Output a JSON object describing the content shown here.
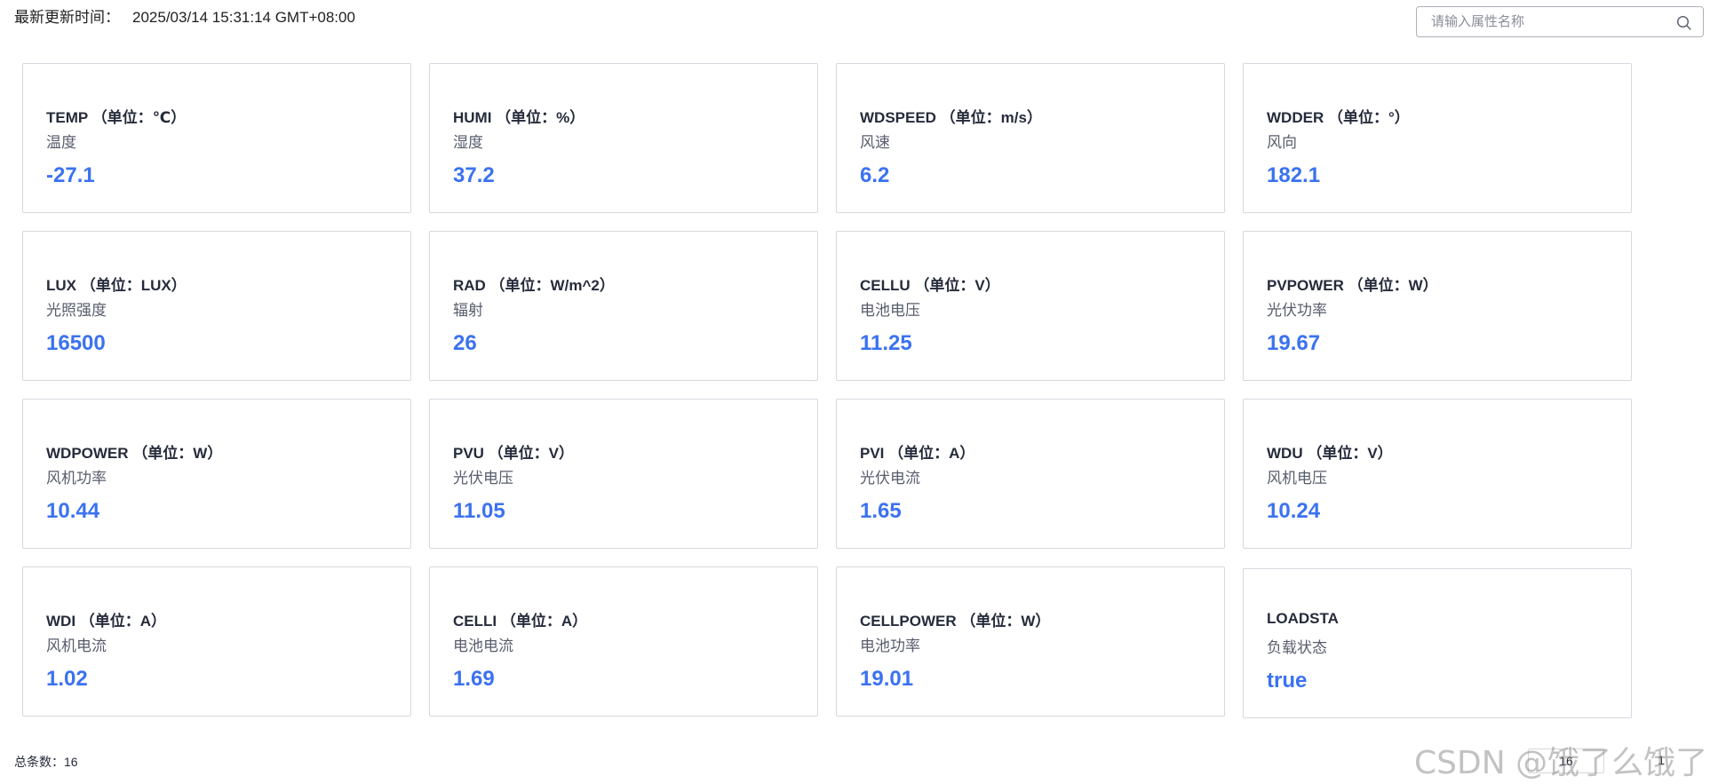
{
  "header": {
    "update_label": "最新更新时间：",
    "update_time": "2025/03/14 15:31:14 GMT+08:00"
  },
  "search": {
    "placeholder": "请输入属性名称",
    "value": ""
  },
  "cards": [
    {
      "title": "TEMP （单位：℃）",
      "desc": "温度",
      "value": "-27.1"
    },
    {
      "title": "HUMI （单位：%）",
      "desc": "湿度",
      "value": "37.2"
    },
    {
      "title": "WDSPEED （单位：m/s）",
      "desc": "风速",
      "value": "6.2"
    },
    {
      "title": "WDDER （单位：°）",
      "desc": "风向",
      "value": "182.1"
    },
    {
      "title": "LUX （单位：LUX）",
      "desc": "光照强度",
      "value": "16500"
    },
    {
      "title": "RAD （单位：W/m^2）",
      "desc": "辐射",
      "value": "26"
    },
    {
      "title": "CELLU （单位：V）",
      "desc": "电池电压",
      "value": "11.25"
    },
    {
      "title": "PVPOWER （单位：W）",
      "desc": "光伏功率",
      "value": "19.67"
    },
    {
      "title": "WDPOWER （单位：W）",
      "desc": "风机功率",
      "value": "10.44"
    },
    {
      "title": "PVU （单位：V）",
      "desc": "光伏电压",
      "value": "11.05"
    },
    {
      "title": "PVI （单位：A）",
      "desc": "光伏电流",
      "value": "1.65"
    },
    {
      "title": "WDU （单位：V）",
      "desc": "风机电压",
      "value": "10.24"
    },
    {
      "title": "WDI （单位：A）",
      "desc": "风机电流",
      "value": "1.02"
    },
    {
      "title": "CELLI （单位：A）",
      "desc": "电池电流",
      "value": "1.69"
    },
    {
      "title": "CELLPOWER （单位：W）",
      "desc": "电池功率",
      "value": "19.01"
    },
    {
      "title": "LOADSTA",
      "desc": "负载状态",
      "value": "true"
    }
  ],
  "footer": {
    "total_label": "总条数：",
    "total": "16",
    "page_size": "16",
    "current_page": "1"
  },
  "watermark": "CSDN @饿了么饿了",
  "colors": {
    "value": "#3b72f0",
    "border": "#d6d8de"
  }
}
